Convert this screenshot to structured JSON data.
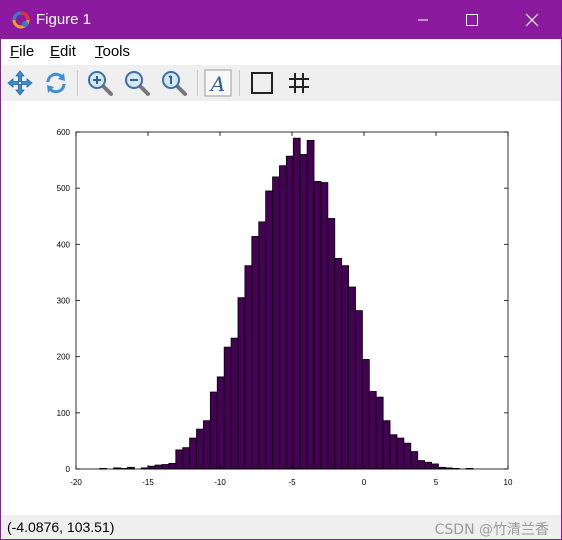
{
  "window": {
    "title": "Figure 1",
    "titlebar_color": "#8b1a9e"
  },
  "menu": {
    "file": "ile",
    "file_mnemonic": "F",
    "edit": "dit",
    "edit_mnemonic": "E",
    "tools": "ools",
    "tools_mnemonic": "T"
  },
  "toolbar": {
    "icons": [
      "pan-icon",
      "rotate-icon",
      "zoom-in-icon",
      "zoom-out-icon",
      "zoom-reset-icon",
      "text-insert-icon",
      "axes-box-icon",
      "grid-icon"
    ],
    "text_icon_label": "A"
  },
  "status": {
    "coordinates": "(-4.0876, 103.51)",
    "watermark": "CSDN @竹清兰香"
  },
  "chart_data": {
    "type": "bar",
    "title": "",
    "xlabel": "",
    "ylabel": "",
    "xlim": [
      -20,
      10
    ],
    "ylim": [
      0,
      600
    ],
    "xticks": [
      "-20",
      "-15",
      "-10",
      "-5",
      "0",
      "5",
      "10"
    ],
    "yticks": [
      "0",
      "100",
      "200",
      "300",
      "400",
      "500",
      "600"
    ],
    "bar_color": "#440154",
    "edge_color": "#000000",
    "bin_width": 0.48,
    "bin_start": -18.35,
    "values": [
      1,
      0,
      2,
      1,
      3,
      0,
      2,
      5,
      7,
      8,
      10,
      34,
      38,
      55,
      71,
      86,
      137,
      164,
      217,
      233,
      305,
      362,
      414,
      440,
      495,
      520,
      540,
      557,
      589,
      560,
      585,
      512,
      510,
      446,
      375,
      362,
      324,
      282,
      195,
      138,
      128,
      86,
      61,
      55,
      46,
      31,
      15,
      12,
      9,
      3,
      2,
      1,
      0,
      1
    ]
  }
}
